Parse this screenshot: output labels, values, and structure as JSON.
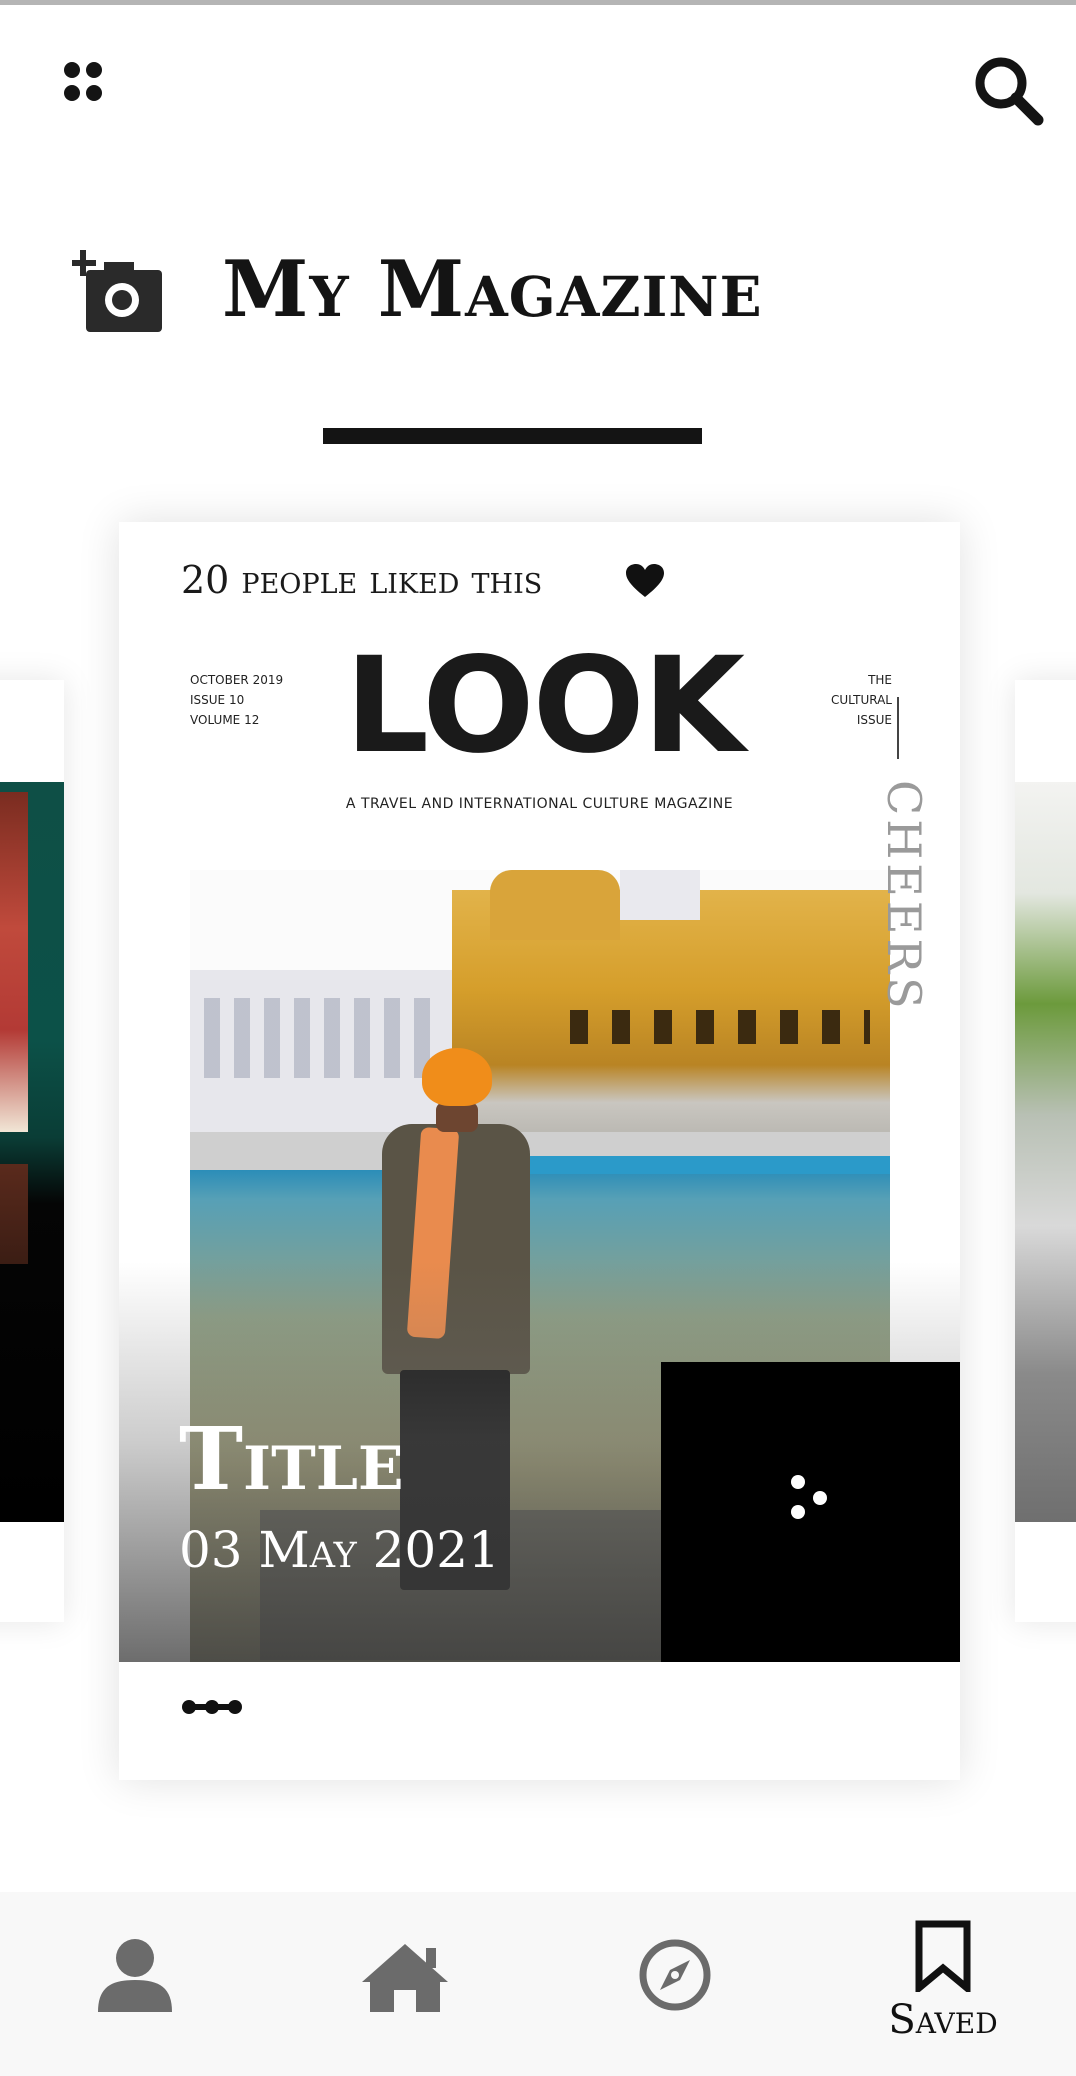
{
  "header": {
    "title": "My Magazine",
    "icons": {
      "menu": "dots-grid-icon",
      "search": "search-icon",
      "add_photo": "add-photo-icon"
    }
  },
  "feature_card": {
    "likes_text": "20 people liked this",
    "likes_icon": "heart-icon",
    "cover": {
      "issue_info": [
        "OCTOBER 2019",
        "ISSUE 10",
        "VOLUME 12"
      ],
      "masthead": "LOOK",
      "edition_info": [
        "THE",
        "CULTURAL",
        "ISSUE"
      ],
      "tagline": "A TRAVEL AND INTERNATIONAL CULTURE MAGAZINE",
      "side_word": "CHEERS"
    },
    "title": "Title",
    "date": "03 May 2021",
    "more_icon": "three-dots-icon",
    "footer_icon": "dots-row-icon"
  },
  "bottom_nav": {
    "items": [
      {
        "id": "profile",
        "icon": "profile-icon",
        "label": ""
      },
      {
        "id": "home",
        "icon": "home-icon",
        "label": ""
      },
      {
        "id": "explore",
        "icon": "compass-icon",
        "label": ""
      },
      {
        "id": "saved",
        "icon": "bookmark-icon",
        "label": "Saved"
      }
    ],
    "active": "saved"
  },
  "colors": {
    "accent": "#141414",
    "nav_background": "#f8f8f8",
    "icon_inactive": "#6b6b6b"
  }
}
